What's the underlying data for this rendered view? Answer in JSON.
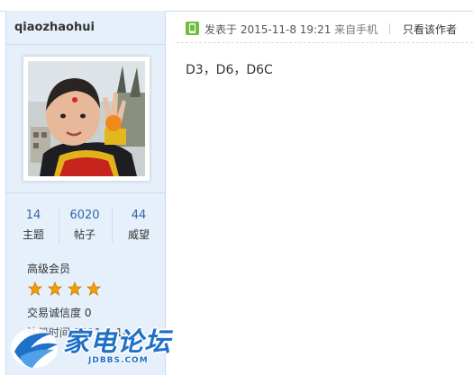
{
  "user": {
    "username": "qiaozhaohui",
    "stats": [
      {
        "value": "14",
        "label": "主题"
      },
      {
        "value": "6020",
        "label": "帖子"
      },
      {
        "value": "44",
        "label": "威望"
      }
    ],
    "rank": "高级会员",
    "star_count": 4,
    "credit": "交易诚信度 0",
    "reg_partial": "注册时间  2011-7-18"
  },
  "post": {
    "posted_prefix": "发表于",
    "datetime": "2015-11-8 19:21",
    "source": "来自手机",
    "only_author": "只看该作者",
    "content": "D3，D6，D6C"
  },
  "watermark": {
    "brand": "家电论坛",
    "domain": "JDBBS.COM"
  },
  "colors": {
    "sidebar_bg": "#E6F0FB",
    "link_blue": "#3366AA",
    "logo_blue": "#1F70C8",
    "star_gold": "#F2A000"
  },
  "icons": {
    "mobile": "mobile-phone-icon",
    "star": "star-icon"
  }
}
